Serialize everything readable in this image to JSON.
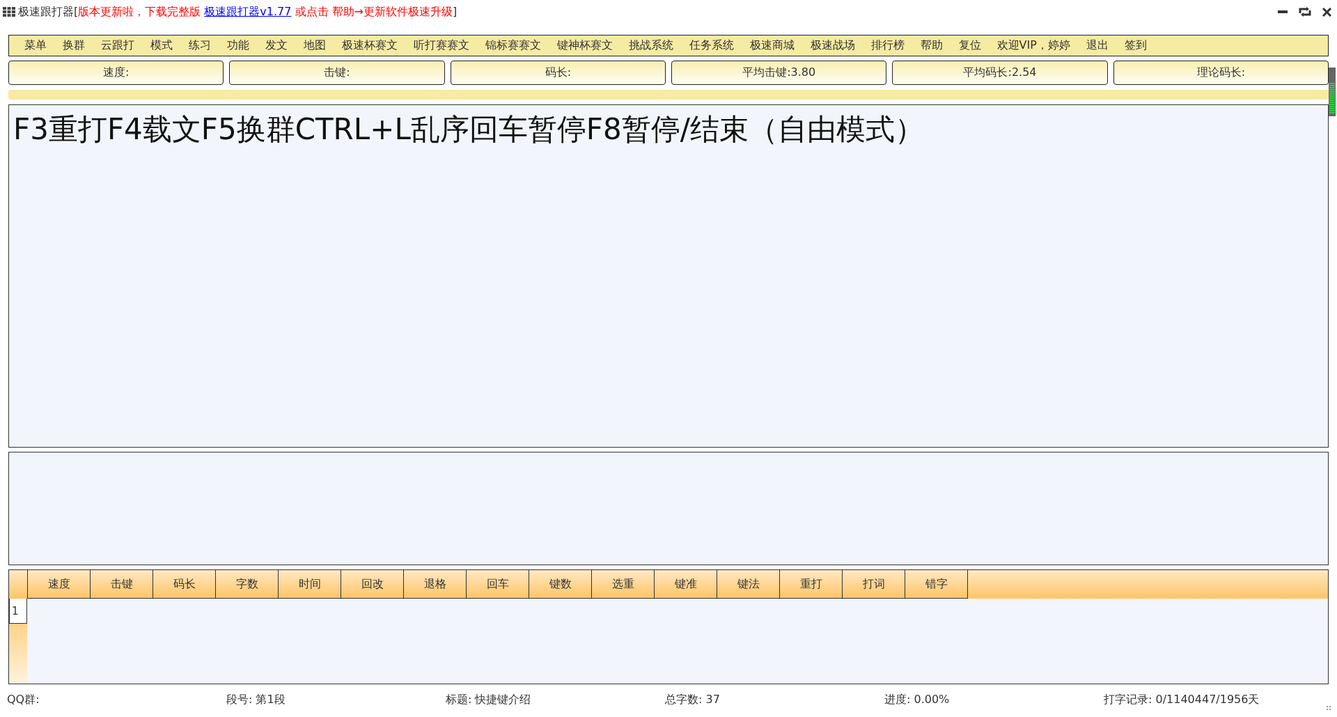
{
  "window": {
    "title": "极速跟打器",
    "notice": [
      {
        "kind": "text",
        "text": "[",
        "color": "#333333"
      },
      {
        "kind": "text",
        "text": "版本更新啦，下载完整版 ",
        "color": "#ff0000"
      },
      {
        "kind": "link",
        "text": "极速跟打器v1.77",
        "color": "#0000ff"
      },
      {
        "kind": "text",
        "text": " 或点击 帮助→更新软件极速升级",
        "color": "#ff0000"
      },
      {
        "kind": "text",
        "text": "]",
        "color": "#333333"
      }
    ]
  },
  "menu": [
    "菜单",
    "换群",
    "云跟打",
    "模式",
    "练习",
    "功能",
    "发文",
    "地图",
    "极速杯赛文",
    "听打赛赛文",
    "锦标赛赛文",
    "键神杯赛文",
    "挑战系统",
    "任务系统",
    "极速商城",
    "极速战场",
    "排行榜",
    "帮助",
    "复位",
    "欢迎VIP，婷婷",
    "退出",
    "签到"
  ],
  "stats": [
    "速度:",
    "击键:",
    "码长:",
    "平均击键:3.80",
    "平均码长:2.54",
    "理论码长:"
  ],
  "article": {
    "text": "F3重打F4载文F5换群CTRL+L乱序回车暂停F8暂停/结束（自由模式）"
  },
  "results": {
    "columns": [
      "速度",
      "击键",
      "码长",
      "字数",
      "时间",
      "回改",
      "退格",
      "回车",
      "键数",
      "选重",
      "键准",
      "键法",
      "重打",
      "打词",
      "错字"
    ],
    "rows": [
      "1"
    ]
  },
  "status_bar": [
    "QQ群:",
    "段号: 第1段",
    "标题: 快捷键介绍",
    "总字数: 37",
    "进度: 0.00%",
    "打字记录: 0/1140447/1956天"
  ]
}
